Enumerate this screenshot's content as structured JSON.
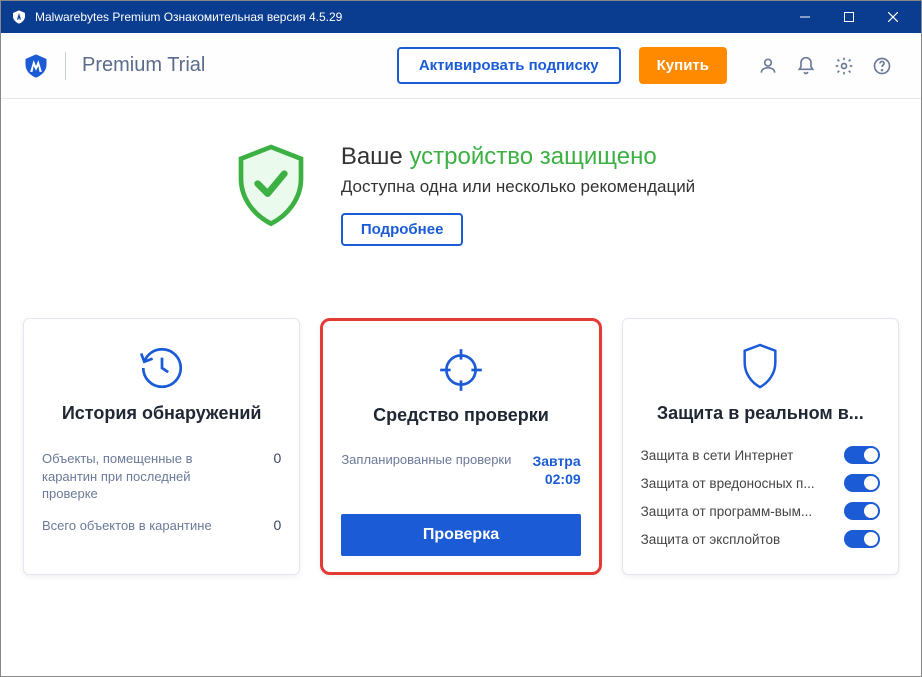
{
  "titlebar": {
    "title": "Malwarebytes Premium Ознакомительная версия  4.5.29"
  },
  "header": {
    "brand": "Premium Trial",
    "activate": "Активировать подписку",
    "buy": "Купить"
  },
  "status": {
    "prefix": "Ваше ",
    "protected": "устройство защищено",
    "subtitle": "Доступна одна или несколько рекомендаций",
    "more": "Подробнее"
  },
  "cards": {
    "history": {
      "title": "История обнаружений",
      "row1_label": "Объекты, помещенные в карантин при последней проверке",
      "row1_value": "0",
      "row2_label": "Всего объектов в карантине",
      "row2_value": "0"
    },
    "scanner": {
      "title": "Средство проверки",
      "sched_label": "Запланированные проверки",
      "sched_day": "Завтра",
      "sched_time": "02:09",
      "scan_btn": "Проверка"
    },
    "protection": {
      "title": "Защита в реальном в...",
      "t1": "Защита в сети Интернет",
      "t2": "Защита от вредоносных п...",
      "t3": "Защита от программ-вым...",
      "t4": "Защита от эксплойтов"
    }
  }
}
